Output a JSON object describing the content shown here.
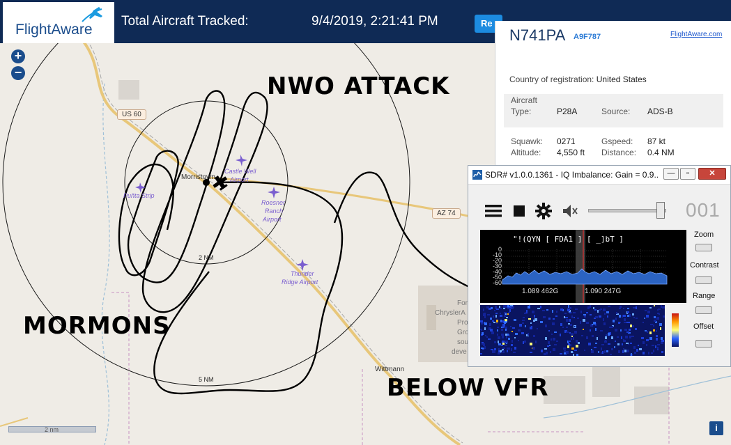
{
  "colors": {
    "header_bg": "#0f2a55",
    "brand_blue": "#1b4d8c",
    "button_blue": "#1c8be0",
    "map_bg": "#efece6",
    "road": "#e8c77a",
    "airport": "#7a5ecf"
  },
  "header": {
    "logo_text": "FlightAware",
    "logo_icon": "plane-icon",
    "title": "Total Aircraft Tracked:",
    "datetime": "9/4/2019, 2:21:41 PM",
    "button_label": "Re"
  },
  "map": {
    "zoom_in": "+",
    "zoom_out": "−",
    "route_labels": [
      "US 60",
      "AZ 74"
    ],
    "town_labels": [
      "Morristown",
      "Wittmann"
    ],
    "airports": [
      "Puñta Strip",
      "Castle Well",
      "Airport",
      "Roesner",
      "Ranch",
      "Airport",
      "Thunder",
      "Ridge Airport"
    ],
    "range_labels": [
      "2 NM",
      "5 NM"
    ],
    "partial_labels": [
      "For",
      "ChryslerA",
      "Pro",
      "Gro",
      "sou",
      "deve"
    ],
    "scale_label": "2 nm",
    "info_button": "i"
  },
  "overlays": {
    "top": "NWO ATTACK",
    "left": "MORMONS",
    "bottom": "BELOW VFR"
  },
  "aircraft": {
    "registration": "N741PA",
    "hex": "A9F787",
    "link": "FlightAware.com",
    "country_label": "Country of registration:",
    "country": "United States",
    "section_label": "Aircraft",
    "type_label": "Type:",
    "type": "P28A",
    "source_label": "Source:",
    "source": "ADS-B",
    "squawk_label": "Squawk:",
    "squawk": "0271",
    "gspeed_label": "Gspeed:",
    "gspeed": "87 kt",
    "altitude_label": "Altitude:",
    "altitude": "4,550 ft",
    "distance_label": "Distance:",
    "distance": "0.4 NM"
  },
  "sdr": {
    "title": "SDR# v1.0.0.1361 - IQ Imbalance: Gain = 0.9...",
    "freq_display": "001",
    "rds_text": "\"!(QYN [ FDA1 ] [ _]bT ]",
    "db_ticks": [
      "0",
      "-10",
      "-20",
      "-30",
      "-40",
      "-50",
      "-60"
    ],
    "freq_labels": [
      "1.089 462G",
      "1.090 247G"
    ],
    "zoom_label": "Zoom",
    "contrast_label": "Contrast",
    "range_label": "Range",
    "offset_label": "Offset",
    "min_icon": "minimize-icon",
    "max_icon": "maximize-icon",
    "close_icon": "close-icon"
  }
}
